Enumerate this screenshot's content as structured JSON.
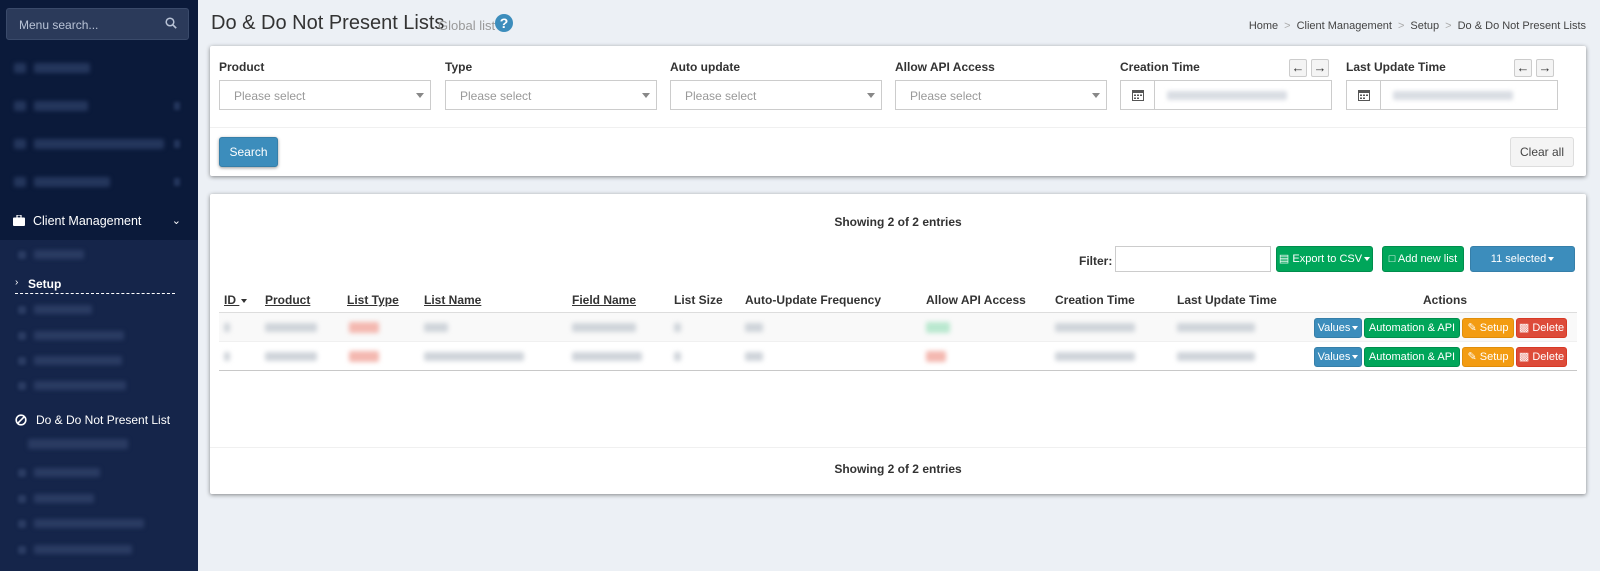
{
  "sidebar": {
    "search_placeholder": "Menu search...",
    "client_management": "Client Management",
    "setup": "Setup",
    "active_item": "Do & Do Not Present List"
  },
  "header": {
    "title": "Do & Do Not Present Lists",
    "subtitle": "Global list",
    "help": "?",
    "breadcrumb": [
      "Home",
      "Client Management",
      "Setup",
      "Do & Do Not Present Lists"
    ]
  },
  "filters": {
    "product_label": "Product",
    "type_label": "Type",
    "auto_update_label": "Auto update",
    "api_access_label": "Allow API Access",
    "creation_time_label": "Creation Time",
    "last_update_label": "Last Update Time",
    "placeholder": "Please select",
    "search_button": "Search",
    "clear_button": "Clear all"
  },
  "table": {
    "showing_text": "Showing 2 of 2 entries",
    "filter_label": "Filter:",
    "export_button": "Export to CSV",
    "add_button": "Add new list",
    "selected_button": "11 selected",
    "columns": [
      "ID",
      "Product",
      "List Type",
      "List Name",
      "Field Name",
      "List Size",
      "Auto-Update Frequency",
      "Allow API Access",
      "Creation Time",
      "Last Update Time",
      "Actions"
    ],
    "actions": {
      "values": "Values",
      "automation": "Automation & API",
      "setup": "Setup",
      "delete": "Delete"
    }
  },
  "colors": {
    "primary": "#3c8dbc",
    "success": "#00a65a",
    "warning": "#f39c12",
    "danger": "#dd4b39",
    "sidebar": "#0b1a3a"
  }
}
